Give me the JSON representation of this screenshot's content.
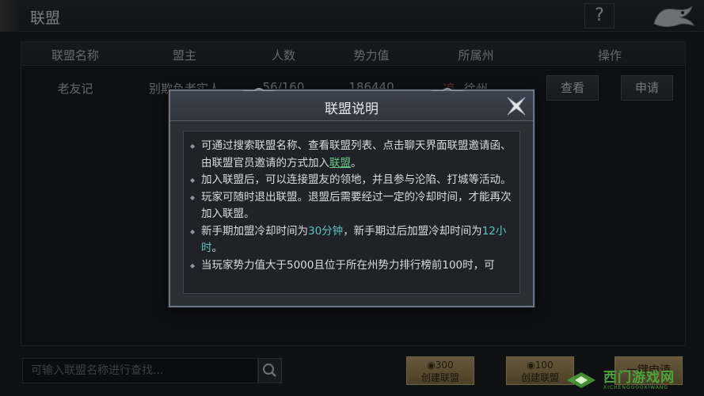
{
  "header": {
    "title": "联盟",
    "help_label": "?"
  },
  "table": {
    "columns": [
      "联盟名称",
      "盟主",
      "人数",
      "势力值",
      "所属州",
      "操作"
    ],
    "rows": [
      {
        "name": "老友记",
        "leader": "别欺负老实人",
        "members": "56/160",
        "power": "186440",
        "flag": "凉",
        "state": "徐州",
        "view_label": "查看",
        "apply_label": "申请"
      }
    ]
  },
  "search": {
    "placeholder": "可输入联盟名称进行查找..."
  },
  "actions": {
    "create_gold": {
      "cost": "300",
      "label": "创建联盟"
    },
    "create_jade": {
      "cost": "100",
      "label": "创建联盟"
    },
    "one_key_apply": "一键申请"
  },
  "watermark": {
    "text": "西门游戏网",
    "sub": "XICHENGGOOXIWANG"
  },
  "modal": {
    "title": "联盟说明",
    "bullets": [
      {
        "text": "可通过搜索联盟名称、查看联盟列表、点击聊天界面联盟邀请函、由联盟官员邀请的方式加入",
        "link": "联盟",
        "tail": "。"
      },
      {
        "text": "加入联盟后，可以连接盟友的领地，并且参与沦陷、打城等活动。"
      },
      {
        "text": "玩家可随时退出联盟。退盟后需要经过一定的冷却时间，才能再次加入联盟。"
      },
      {
        "pre": "新手期加盟冷却时间为",
        "v1": "30分钟",
        "mid": "，新手期过后加盟冷却时间为",
        "v2": "12小时",
        "tail": "。"
      },
      {
        "text": "当玩家势力值大于5000且位于所在州势力排行榜前100时，可"
      }
    ]
  },
  "colors": {
    "accent_green": "#69c88a",
    "accent_cyan": "#5fc3c0",
    "gold_button": "#b8a06c"
  }
}
